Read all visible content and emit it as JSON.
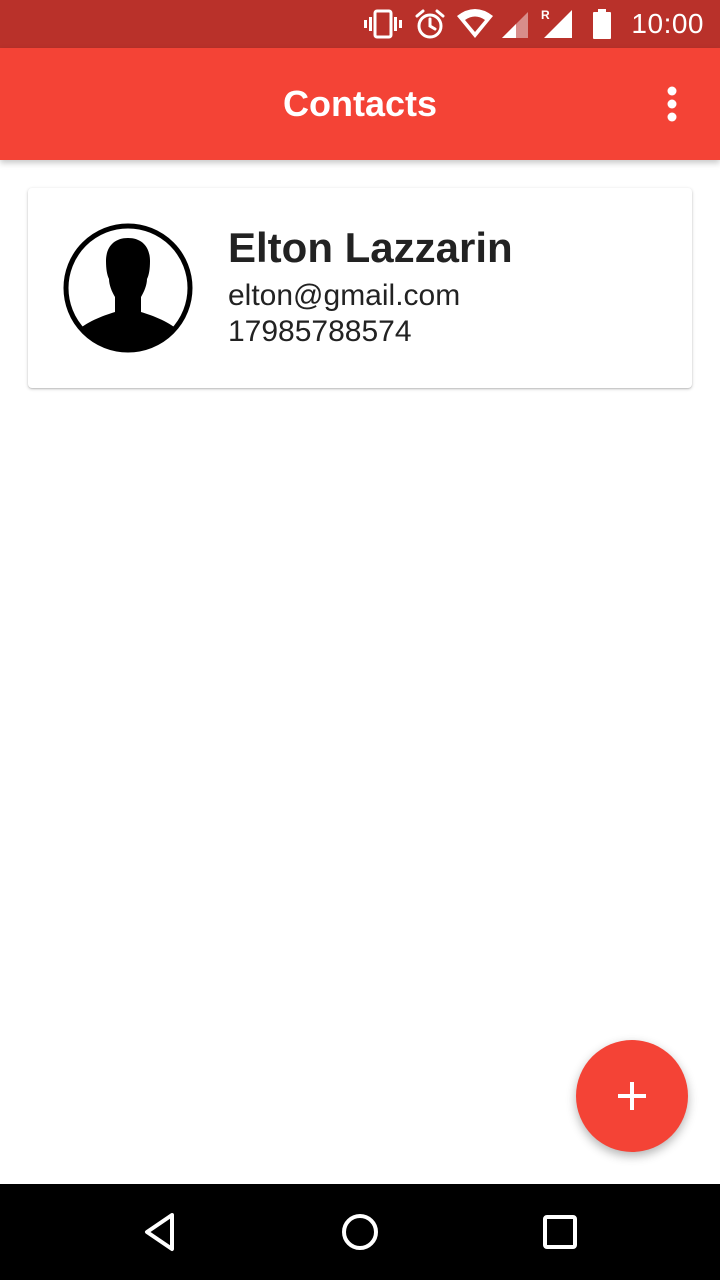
{
  "status_bar": {
    "time": "10:00",
    "icons": [
      "vibrate-icon",
      "alarm-icon",
      "wifi-icon",
      "cell-signal-icon",
      "roaming-signal-icon",
      "battery-icon"
    ],
    "roaming_label": "R"
  },
  "app_bar": {
    "title": "Contacts",
    "overflow_icon": "more-vert-icon"
  },
  "contacts": [
    {
      "name": "Elton Lazzarin",
      "email": "elton@gmail.com",
      "phone": "17985788574",
      "avatar_icon": "person-silhouette-icon"
    }
  ],
  "fab": {
    "icon": "plus-icon"
  },
  "nav_bar": {
    "icons": [
      "back-icon",
      "home-icon",
      "recents-icon"
    ]
  },
  "colors": {
    "status_bar": "#b9312a",
    "primary": "#f44336",
    "text_primary": "#222222",
    "nav_bar": "#000000"
  }
}
